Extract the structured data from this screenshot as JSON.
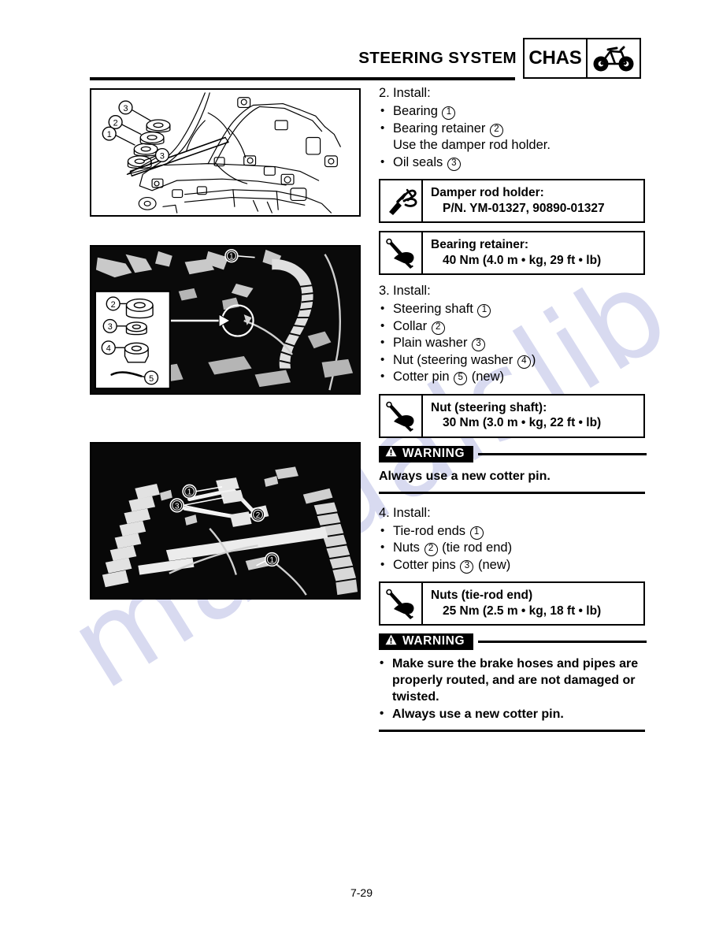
{
  "header": {
    "title": "STEERING SYSTEM",
    "badge_word": "CHAS",
    "badge_icon": "atv-icon"
  },
  "figures": [
    {
      "name": "frame-bearing-exploded-drawing",
      "type": "line-drawing",
      "callouts": [
        "1",
        "2",
        "3",
        "3"
      ]
    },
    {
      "name": "steering-shaft-photo",
      "type": "photo",
      "callouts": [
        "1",
        "2",
        "3",
        "4",
        "5"
      ]
    },
    {
      "name": "tie-rod-end-photo",
      "type": "photo",
      "callouts": [
        "1",
        "2",
        "3",
        "1"
      ]
    }
  ],
  "steps": [
    {
      "number": "2.",
      "title": "Install:",
      "items": [
        {
          "text": "Bearing",
          "ref": "1"
        },
        {
          "text": "Bearing retainer",
          "ref": "2"
        },
        {
          "sub": "Use the damper rod holder."
        },
        {
          "text": "Oil seals",
          "ref": "3"
        }
      ],
      "specs": [
        {
          "icon": "damper-rod-holder-icon",
          "line1": "Damper rod holder:",
          "line2": "P/N. YM-01327, 90890-01327"
        },
        {
          "icon": "torque-wrench-icon",
          "line1": "Bearing retainer:",
          "line2": "40 Nm (4.0 m • kg, 29 ft • lb)"
        }
      ]
    },
    {
      "number": "3.",
      "title": "Install:",
      "items": [
        {
          "text": "Steering shaft",
          "ref": "1"
        },
        {
          "text": "Collar",
          "ref": "2"
        },
        {
          "text": "Plain washer",
          "ref": "3"
        },
        {
          "text": "Nut (steering washer",
          "ref": "4",
          "after": ")"
        },
        {
          "text": "Cotter pin",
          "ref": "5",
          "after": " (new)"
        }
      ],
      "specs": [
        {
          "icon": "torque-wrench-icon",
          "line1": "Nut (steering shaft):",
          "line2": "30 Nm (3.0 m • kg, 22 ft • lb)"
        }
      ],
      "warning": {
        "label": "WARNING",
        "icon": "warning-triangle-icon",
        "lines": [
          "Always use a new cotter pin."
        ],
        "bulleted": false
      }
    },
    {
      "number": "4.",
      "title": "Install:",
      "items": [
        {
          "text": "Tie-rod ends",
          "ref": "1"
        },
        {
          "text": "Nuts",
          "ref": "2",
          "after": " (tie rod end)"
        },
        {
          "text": "Cotter pins",
          "ref": "3",
          "after": " (new)"
        }
      ],
      "specs": [
        {
          "icon": "torque-wrench-icon",
          "line1": "Nuts (tie-rod end)",
          "line2": "25 Nm (2.5 m • kg, 18 ft • lb)"
        }
      ],
      "warning": {
        "label": "WARNING",
        "icon": "warning-triangle-icon",
        "lines": [
          "Make sure the brake hoses and pipes are properly routed, and are not damaged or twisted.",
          "Always use a new cotter pin."
        ],
        "bulleted": true
      }
    }
  ],
  "watermark": {
    "text": "manualslib"
  },
  "footer": {
    "page_number": "7-29"
  },
  "colors": {
    "ink": "#000000",
    "paper": "#ffffff",
    "watermark": "#b9bde4"
  }
}
